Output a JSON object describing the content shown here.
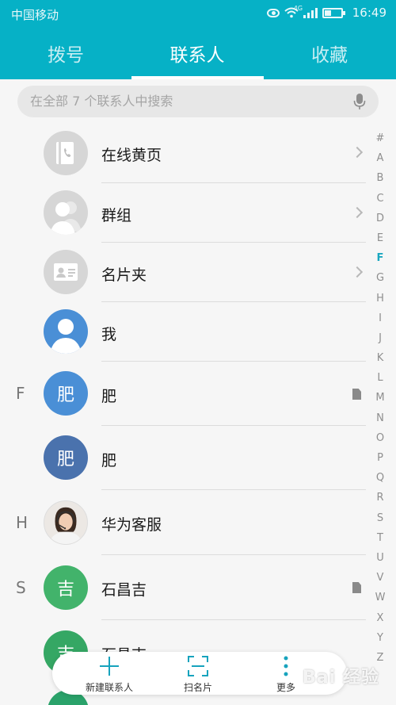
{
  "status_bar": {
    "carrier": "中国移动",
    "network": "4G",
    "time": "16:49"
  },
  "tabs": [
    {
      "label": "拨号",
      "active": false
    },
    {
      "label": "联系人",
      "active": true
    },
    {
      "label": "收藏",
      "active": false
    }
  ],
  "search": {
    "placeholder": "在全部 7 个联系人中搜索"
  },
  "contacts": [
    {
      "name": "在线黄页",
      "icon": "yellow-pages-icon",
      "chevron": true
    },
    {
      "name": "群组",
      "icon": "group-icon",
      "chevron": true
    },
    {
      "name": "名片夹",
      "icon": "business-card-icon",
      "chevron": true
    },
    {
      "name": "我",
      "icon": "person-icon"
    },
    {
      "section": "F",
      "name": "肥",
      "avatar_text": "肥",
      "avatar_color": "#4a8fd6",
      "sim": true
    },
    {
      "name": "肥",
      "avatar_text": "肥",
      "avatar_color": "#4a72ad"
    },
    {
      "section": "H",
      "name": "华为客服",
      "icon": "support-agent-photo"
    },
    {
      "section": "S",
      "name": "石昌吉",
      "avatar_text": "吉",
      "avatar_color": "#42b36b",
      "sim": true
    },
    {
      "name": "石昌吉",
      "avatar_text": "吉",
      "avatar_color": "#35a764"
    }
  ],
  "alpha_index": [
    "#",
    "A",
    "B",
    "C",
    "D",
    "E",
    "F",
    "G",
    "H",
    "I",
    "J",
    "K",
    "L",
    "M",
    "N",
    "O",
    "P",
    "Q",
    "R",
    "S",
    "T",
    "U",
    "V",
    "W",
    "X",
    "Y",
    "Z"
  ],
  "alpha_active": "F",
  "bottom_bar": {
    "new_contact": "新建联系人",
    "scan_card": "扫名片",
    "more": "更多"
  },
  "watermark": "Bai 经验",
  "colors": {
    "accent": "#06b1c6",
    "index_active": "#1aa7c0"
  }
}
